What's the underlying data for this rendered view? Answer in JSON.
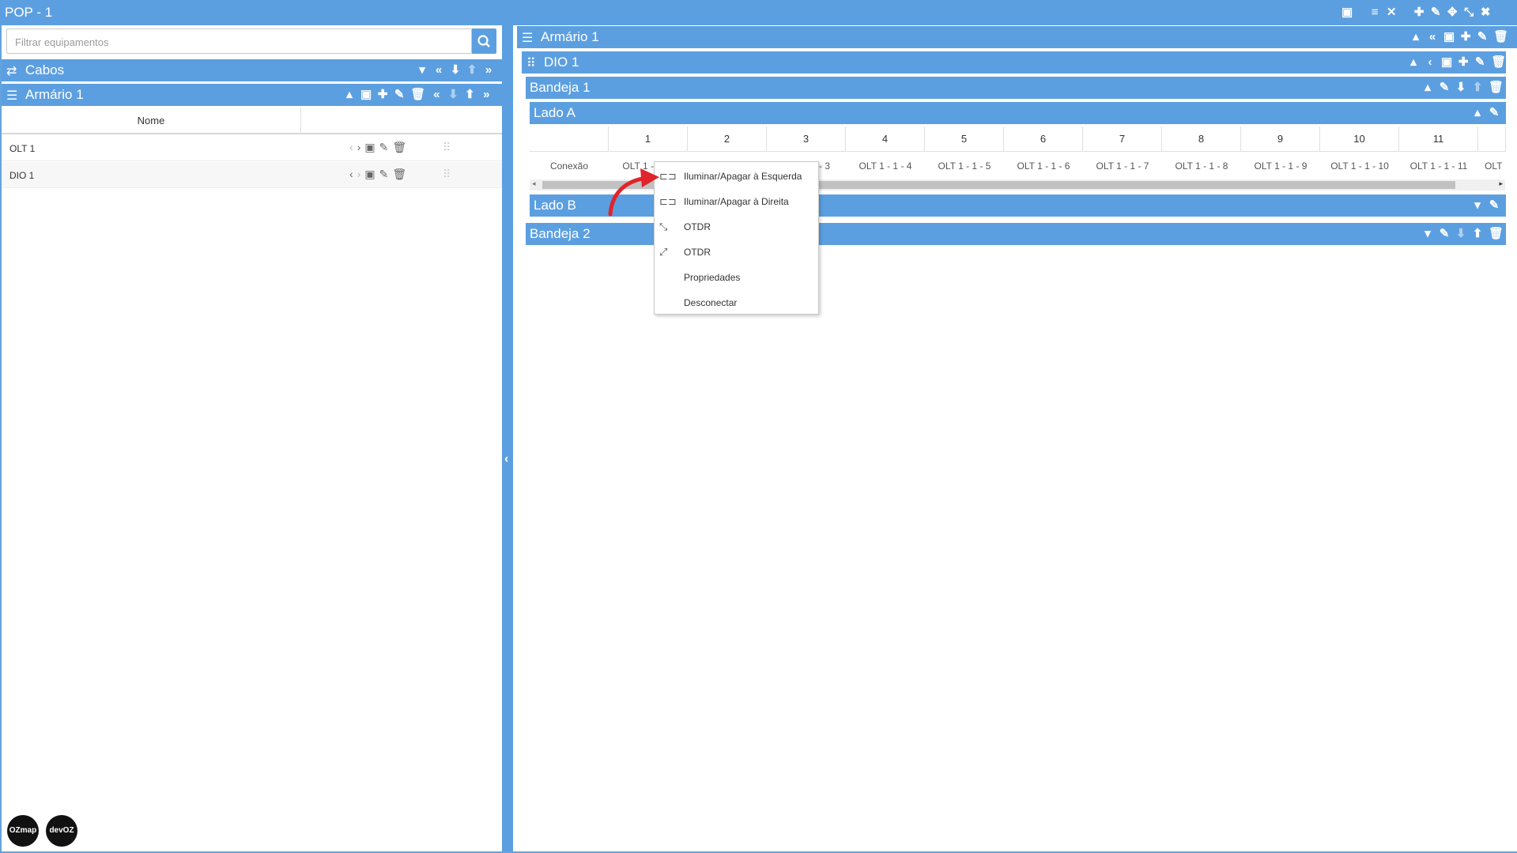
{
  "window": {
    "title": "POP - 1"
  },
  "left": {
    "search": {
      "placeholder": "Filtrar equipamentos"
    },
    "cabos": {
      "label": "Cabos"
    },
    "armario": {
      "label": "Armário 1"
    },
    "table": {
      "header": "Nome"
    },
    "rows": [
      {
        "name": "OLT 1"
      },
      {
        "name": "DIO 1"
      }
    ],
    "logos": [
      "OZmap",
      "devOZ"
    ]
  },
  "right": {
    "armario": {
      "label": "Armário 1"
    },
    "dio": {
      "label": "DIO 1"
    },
    "bandeja1": {
      "label": "Bandeja 1"
    },
    "ladoA": {
      "label": "Lado A"
    },
    "ladoB": {
      "label": "Lado B"
    },
    "bandeja2": {
      "label": "Bandeja 2"
    },
    "grid": {
      "row_label": "Conexão",
      "columns": [
        "1",
        "2",
        "3",
        "4",
        "5",
        "6",
        "7",
        "8",
        "9",
        "10",
        "11"
      ],
      "cells": [
        "OLT 1 -",
        "",
        "- 3",
        "OLT 1 - 1 - 4",
        "OLT 1 - 1 - 5",
        "OLT 1 - 1 - 6",
        "OLT 1 - 1 - 7",
        "OLT 1 - 1 - 8",
        "OLT 1 - 1 - 9",
        "OLT 1 - 1 - 10",
        "OLT 1 - 1 - 11",
        "OLT"
      ]
    }
  },
  "context_menu": {
    "items": [
      {
        "label": "Iluminar/Apagar à Esquerda",
        "icon": "laser-left-icon"
      },
      {
        "label": "Iluminar/Apagar à Direita",
        "icon": "laser-right-icon"
      },
      {
        "label": "OTDR",
        "icon": "otdr-icon"
      },
      {
        "label": "OTDR",
        "icon": "otdr-reverse-icon"
      },
      {
        "label": "Propriedades",
        "icon": ""
      },
      {
        "label": "Desconectar",
        "icon": ""
      }
    ]
  },
  "colors": {
    "accent": "#5c9fe0",
    "arrow": "#e0242b"
  }
}
